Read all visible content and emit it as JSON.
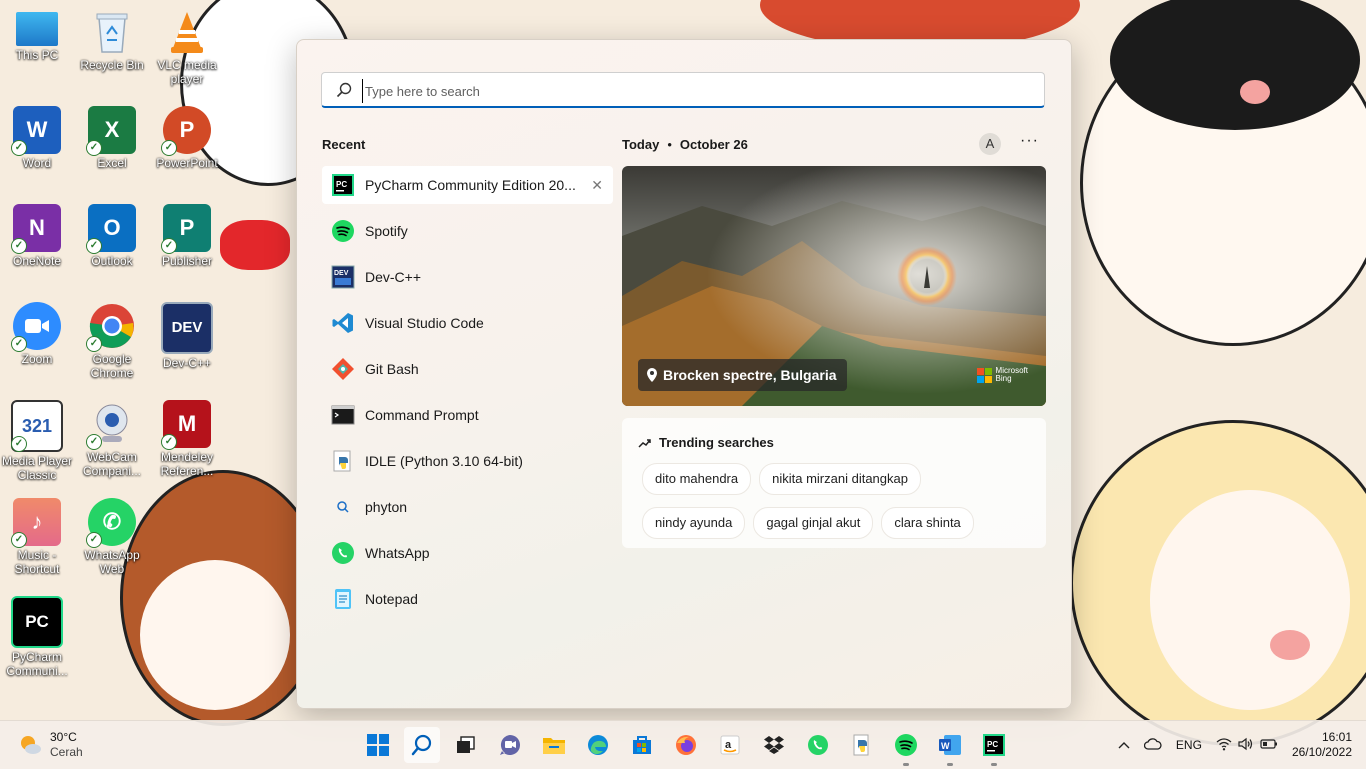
{
  "desktop": {
    "icons": [
      {
        "label": "This PC"
      },
      {
        "label": "Recycle Bin"
      },
      {
        "label": "VLC media player"
      },
      {
        "label": "Word"
      },
      {
        "label": "Excel"
      },
      {
        "label": "PowerPoint"
      },
      {
        "label": "OneNote"
      },
      {
        "label": "Outlook"
      },
      {
        "label": "Publisher"
      },
      {
        "label": "Zoom"
      },
      {
        "label": "Google Chrome"
      },
      {
        "label": "Dev-C++"
      },
      {
        "label": "Media Player Classic"
      },
      {
        "label": "WebCam Compani..."
      },
      {
        "label": "Mendeley Referen..."
      },
      {
        "label": "Music - Shortcut"
      },
      {
        "label": "WhatsApp Web"
      },
      {
        "label": "PyCharm Communi..."
      }
    ]
  },
  "search": {
    "placeholder": "Type here to search"
  },
  "recent": {
    "title": "Recent",
    "items": [
      {
        "label": "PyCharm Community Edition 20...",
        "icon": "pycharm-icon"
      },
      {
        "label": "Spotify",
        "icon": "spotify-icon"
      },
      {
        "label": "Dev-C++",
        "icon": "devcpp-icon"
      },
      {
        "label": "Visual Studio Code",
        "icon": "vscode-icon"
      },
      {
        "label": "Git Bash",
        "icon": "git-bash-icon"
      },
      {
        "label": "Command Prompt",
        "icon": "command-prompt-icon"
      },
      {
        "label": "IDLE (Python 3.10 64-bit)",
        "icon": "python-idle-icon"
      },
      {
        "label": "phyton",
        "icon": "search-icon"
      },
      {
        "label": "WhatsApp",
        "icon": "whatsapp-icon"
      },
      {
        "label": "Notepad",
        "icon": "notepad-icon"
      }
    ]
  },
  "today": {
    "label": "Today",
    "date": "October 26",
    "avatar_letter": "A",
    "more": "···"
  },
  "hero": {
    "caption": "Brocken spectre, Bulgaria",
    "brand_line1": "Microsoft",
    "brand_line2": "Bing"
  },
  "trending": {
    "title": "Trending searches",
    "chips": [
      "dito mahendra",
      "nikita mirzani ditangkap",
      "nindy ayunda",
      "gagal ginjal akut",
      "clara shinta"
    ]
  },
  "taskbar": {
    "weather_temp": "30°C",
    "weather_desc": "Cerah",
    "language": "ENG",
    "time": "16:01",
    "date": "26/10/2022",
    "apps": [
      "start-icon",
      "search-icon",
      "task-view-icon",
      "teams-chat-icon",
      "file-explorer-icon",
      "edge-icon",
      "store-icon",
      "firefox-icon",
      "amazon-icon",
      "dropbox-icon",
      "whatsapp-icon",
      "python-icon",
      "spotify-icon",
      "word-icon",
      "pycharm-icon"
    ]
  },
  "colors": {
    "accent": "#005fb8",
    "wallpaper": "#f6ecde"
  }
}
